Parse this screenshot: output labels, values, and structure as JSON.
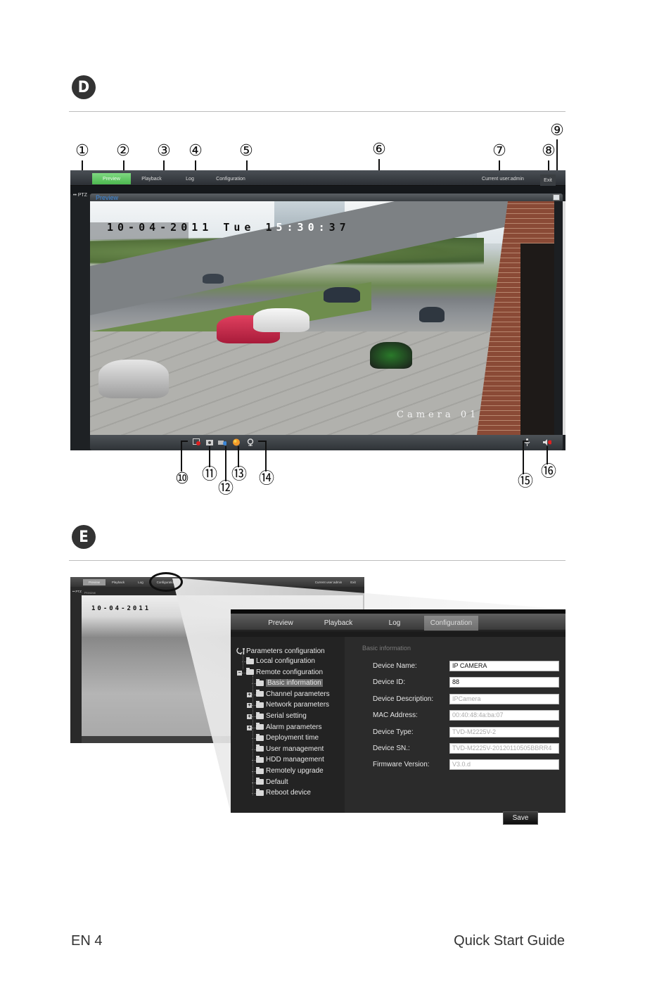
{
  "sections": {
    "d": {
      "badge": "D"
    },
    "e": {
      "badge": "E"
    }
  },
  "callouts": [
    "①",
    "②",
    "③",
    "④",
    "⑤",
    "⑥",
    "⑦",
    "⑧",
    "⑨",
    "⑩",
    "⑪",
    "⑫",
    "⑬",
    "⑭",
    "⑮",
    "⑯"
  ],
  "preview_app": {
    "nav": {
      "tabs": [
        {
          "label": "Preview",
          "active": true
        },
        {
          "label": "Playback",
          "active": false
        },
        {
          "label": "Log",
          "active": false
        },
        {
          "label": "Configuration",
          "active": false
        }
      ],
      "current_user": "Current user:admin",
      "exit_label": "Exit"
    },
    "ptz_label": "•• PTZ",
    "panel_title": "Preview",
    "osd": {
      "date": "10-04-2011 Tue 15:30:37",
      "date_part": "10-04-2011 Tue 1",
      "time_part": "5:30:",
      "time_tail": "37",
      "camera_name": "Camera 01"
    },
    "controls": {
      "left": [
        "record-icon",
        "snapshot-icon",
        "zoom-camera-icon",
        "color-icon",
        "digital-zoom-icon"
      ],
      "right": [
        "microphone-icon",
        "speaker-icon"
      ]
    },
    "accent_colors": {
      "active_tab": "#5cc35f",
      "panel_title": "#3d8be0",
      "record": "#e02020"
    }
  },
  "config_thumbnail": {
    "tabs": [
      "Preview",
      "Playback",
      "Log",
      "Configuration"
    ],
    "current_user": "Current user:admin",
    "exit_label": "Exit",
    "ptz_label": "•• PTZ",
    "panel_title": "Preview",
    "osd_date": "10-04-2011"
  },
  "config_app": {
    "tabs": [
      {
        "label": "Preview",
        "active": false
      },
      {
        "label": "Playback",
        "active": false
      },
      {
        "label": "Log",
        "active": false
      },
      {
        "label": "Configuration",
        "active": true
      }
    ],
    "tree": {
      "root": "Parameters configuration",
      "items": [
        {
          "label": "Local configuration",
          "level": 1,
          "expander": ""
        },
        {
          "label": "Remote configuration",
          "level": 1,
          "expander": "−"
        },
        {
          "label": "Basic information",
          "level": 2,
          "expander": "",
          "selected": true
        },
        {
          "label": "Channel parameters",
          "level": 2,
          "expander": "+"
        },
        {
          "label": "Network parameters",
          "level": 2,
          "expander": "+"
        },
        {
          "label": "Serial setting",
          "level": 2,
          "expander": "+"
        },
        {
          "label": "Alarm parameters",
          "level": 2,
          "expander": "+"
        },
        {
          "label": "Deployment time",
          "level": 2,
          "expander": ""
        },
        {
          "label": "User management",
          "level": 2,
          "expander": ""
        },
        {
          "label": "HDD management",
          "level": 2,
          "expander": ""
        },
        {
          "label": "Remotely upgrade",
          "level": 2,
          "expander": ""
        },
        {
          "label": "Default",
          "level": 2,
          "expander": ""
        },
        {
          "label": "Reboot device",
          "level": 2,
          "expander": ""
        }
      ]
    },
    "form": {
      "section_title": "Basic information",
      "fields": [
        {
          "label": "Device Name:",
          "value": "IP CAMERA",
          "editable": true
        },
        {
          "label": "Device ID:",
          "value": "88",
          "editable": true
        },
        {
          "label": "Device Description:",
          "value": "IPCamera",
          "editable": false
        },
        {
          "label": "MAC Address:",
          "value": "00:40:48:4a:ba:07",
          "editable": false
        },
        {
          "label": "Device Type:",
          "value": "TVD-M2225V-2",
          "editable": false
        },
        {
          "label": "Device SN.:",
          "value": "TVD-M2225V-20120110505BBRR4",
          "editable": false
        },
        {
          "label": "Firmware Version:",
          "value": "V3.0.d",
          "editable": false
        }
      ],
      "save_label": "Save"
    }
  },
  "footer": {
    "page": "EN 4",
    "title": "Quick Start Guide"
  }
}
